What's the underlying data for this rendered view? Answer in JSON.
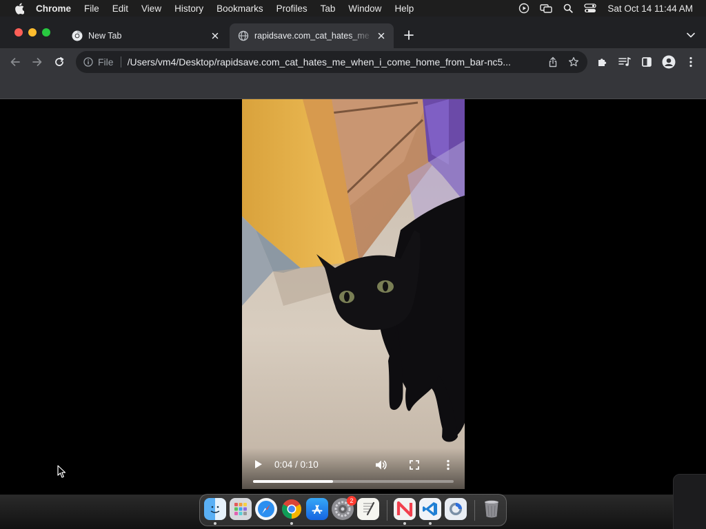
{
  "menubar": {
    "app_name": "Chrome",
    "items": [
      "File",
      "Edit",
      "View",
      "History",
      "Bookmarks",
      "Profiles",
      "Tab",
      "Window",
      "Help"
    ],
    "clock": "Sat Oct 14  11:44 AM"
  },
  "tabs": [
    {
      "title": "New Tab",
      "active": false,
      "favicon": "chrome-icon"
    },
    {
      "title": "rapidsave.com_cat_hates_me",
      "active": true,
      "favicon": "globe-icon"
    }
  ],
  "toolbar": {
    "scheme_label": "File",
    "url": "/Users/vm4/Desktop/rapidsave.com_cat_hates_me_when_i_come_home_from_bar-nc5..."
  },
  "video": {
    "time_display": "0:04 / 0:10",
    "progress_fraction": 0.4
  },
  "dock": {
    "apps": [
      {
        "name": "Finder",
        "icon": "finder-icon",
        "running": true
      },
      {
        "name": "Launchpad",
        "icon": "launchpad-icon",
        "running": false
      },
      {
        "name": "Safari",
        "icon": "safari-icon",
        "running": false
      },
      {
        "name": "Chrome",
        "icon": "chrome-icon",
        "running": true
      },
      {
        "name": "App Store",
        "icon": "app-store-icon",
        "running": false
      },
      {
        "name": "System Settings",
        "icon": "system-settings-icon",
        "running": false,
        "badge": "2"
      },
      {
        "name": "TextEdit",
        "icon": "textedit-icon",
        "running": false
      },
      {
        "name": "News",
        "icon": "news-icon",
        "running": true
      },
      {
        "name": "VS Code",
        "icon": "vscode-icon",
        "running": true
      },
      {
        "name": "Proxyman",
        "icon": "proxyman-icon",
        "running": false
      },
      {
        "name": "Trash",
        "icon": "trash-icon",
        "running": false
      }
    ]
  },
  "colors": {
    "menubar_bg": "#1e1e1e",
    "tabstrip_bg": "#202124",
    "toolbar_bg": "#35363a",
    "omnibox_bg": "#202124",
    "page_bg": "#000000"
  }
}
